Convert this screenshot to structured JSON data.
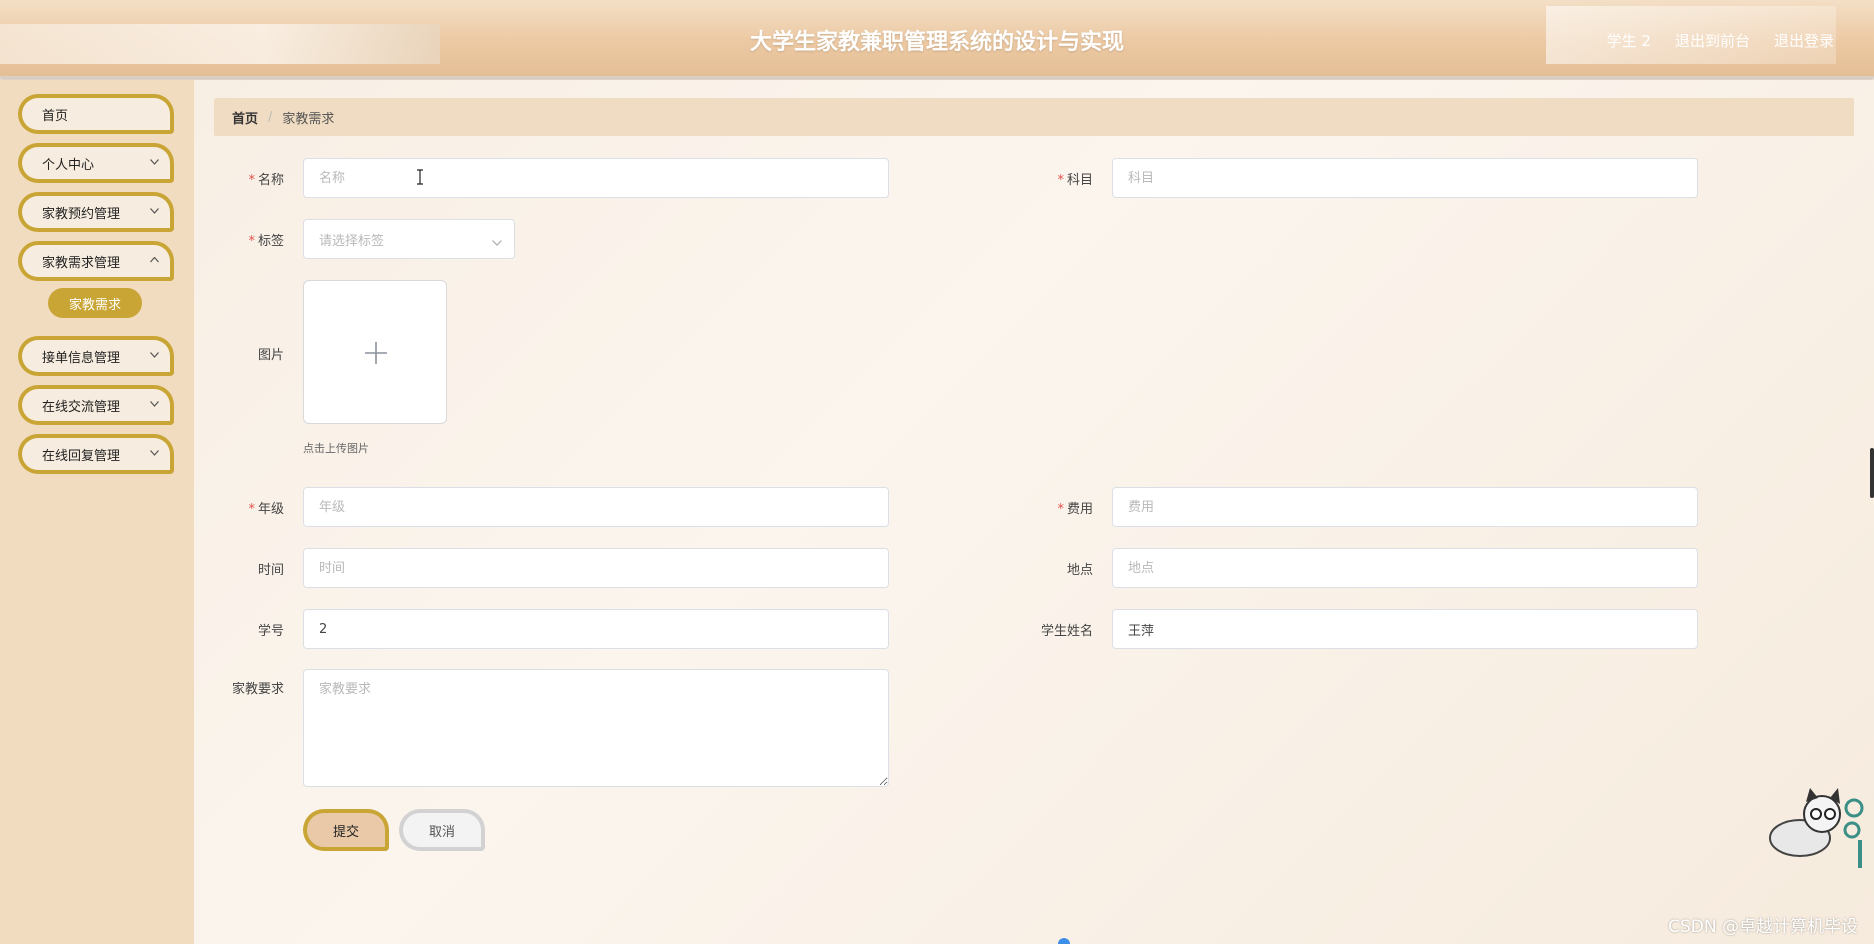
{
  "header": {
    "title": "大学生家教兼职管理系统的设计与实现",
    "user": "学生 2",
    "to_front": "退出到前台",
    "logout": "退出登录"
  },
  "sidebar": {
    "items": [
      {
        "label": "首页"
      },
      {
        "label": "个人中心"
      },
      {
        "label": "家教预约管理"
      },
      {
        "label": "家教需求管理"
      },
      {
        "label": "家教需求"
      },
      {
        "label": "接单信息管理"
      },
      {
        "label": "在线交流管理"
      },
      {
        "label": "在线回复管理"
      }
    ]
  },
  "breadcrumb": {
    "home": "首页",
    "separator": "/",
    "current": "家教需求"
  },
  "form": {
    "name": {
      "label": "名称",
      "placeholder": "名称",
      "value": ""
    },
    "subject": {
      "label": "科目",
      "placeholder": "科目",
      "value": ""
    },
    "tag": {
      "label": "标签",
      "placeholder": "请选择标签"
    },
    "image": {
      "label": "图片",
      "tip": "点击上传图片"
    },
    "grade": {
      "label": "年级",
      "placeholder": "年级",
      "value": ""
    },
    "fee": {
      "label": "费用",
      "placeholder": "费用",
      "value": ""
    },
    "time": {
      "label": "时间",
      "placeholder": "时间",
      "value": ""
    },
    "location": {
      "label": "地点",
      "placeholder": "地点",
      "value": ""
    },
    "student_no": {
      "label": "学号",
      "value": "2"
    },
    "student_name": {
      "label": "学生姓名",
      "value": "王萍"
    },
    "requirement": {
      "label": "家教要求",
      "placeholder": "家教要求",
      "value": ""
    },
    "required_mark": "*"
  },
  "buttons": {
    "submit": "提交",
    "cancel": "取消"
  },
  "watermark": "CSDN @卓越计算机毕设",
  "colors": {
    "accent": "#c9a535",
    "header_bg": "#ecc9a3",
    "sidebar_bg": "#f1dcc0",
    "required": "#e0514a"
  },
  "icons": {
    "chevron": "chevron-down-icon",
    "plus": "plus-icon"
  }
}
